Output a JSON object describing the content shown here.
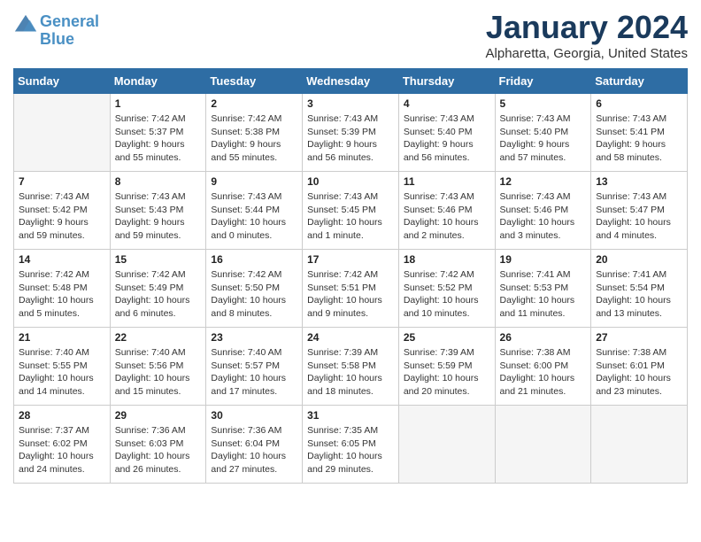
{
  "header": {
    "logo_line1": "General",
    "logo_line2": "Blue",
    "month_title": "January 2024",
    "location": "Alpharetta, Georgia, United States"
  },
  "weekdays": [
    "Sunday",
    "Monday",
    "Tuesday",
    "Wednesday",
    "Thursday",
    "Friday",
    "Saturday"
  ],
  "weeks": [
    [
      {
        "day": "",
        "sunrise": "",
        "sunset": "",
        "daylight": "",
        "empty": true
      },
      {
        "day": "1",
        "sunrise": "Sunrise: 7:42 AM",
        "sunset": "Sunset: 5:37 PM",
        "daylight": "Daylight: 9 hours and 55 minutes."
      },
      {
        "day": "2",
        "sunrise": "Sunrise: 7:42 AM",
        "sunset": "Sunset: 5:38 PM",
        "daylight": "Daylight: 9 hours and 55 minutes."
      },
      {
        "day": "3",
        "sunrise": "Sunrise: 7:43 AM",
        "sunset": "Sunset: 5:39 PM",
        "daylight": "Daylight: 9 hours and 56 minutes."
      },
      {
        "day": "4",
        "sunrise": "Sunrise: 7:43 AM",
        "sunset": "Sunset: 5:40 PM",
        "daylight": "Daylight: 9 hours and 56 minutes."
      },
      {
        "day": "5",
        "sunrise": "Sunrise: 7:43 AM",
        "sunset": "Sunset: 5:40 PM",
        "daylight": "Daylight: 9 hours and 57 minutes."
      },
      {
        "day": "6",
        "sunrise": "Sunrise: 7:43 AM",
        "sunset": "Sunset: 5:41 PM",
        "daylight": "Daylight: 9 hours and 58 minutes."
      }
    ],
    [
      {
        "day": "7",
        "sunrise": "Sunrise: 7:43 AM",
        "sunset": "Sunset: 5:42 PM",
        "daylight": "Daylight: 9 hours and 59 minutes."
      },
      {
        "day": "8",
        "sunrise": "Sunrise: 7:43 AM",
        "sunset": "Sunset: 5:43 PM",
        "daylight": "Daylight: 9 hours and 59 minutes."
      },
      {
        "day": "9",
        "sunrise": "Sunrise: 7:43 AM",
        "sunset": "Sunset: 5:44 PM",
        "daylight": "Daylight: 10 hours and 0 minutes."
      },
      {
        "day": "10",
        "sunrise": "Sunrise: 7:43 AM",
        "sunset": "Sunset: 5:45 PM",
        "daylight": "Daylight: 10 hours and 1 minute."
      },
      {
        "day": "11",
        "sunrise": "Sunrise: 7:43 AM",
        "sunset": "Sunset: 5:46 PM",
        "daylight": "Daylight: 10 hours and 2 minutes."
      },
      {
        "day": "12",
        "sunrise": "Sunrise: 7:43 AM",
        "sunset": "Sunset: 5:46 PM",
        "daylight": "Daylight: 10 hours and 3 minutes."
      },
      {
        "day": "13",
        "sunrise": "Sunrise: 7:43 AM",
        "sunset": "Sunset: 5:47 PM",
        "daylight": "Daylight: 10 hours and 4 minutes."
      }
    ],
    [
      {
        "day": "14",
        "sunrise": "Sunrise: 7:42 AM",
        "sunset": "Sunset: 5:48 PM",
        "daylight": "Daylight: 10 hours and 5 minutes."
      },
      {
        "day": "15",
        "sunrise": "Sunrise: 7:42 AM",
        "sunset": "Sunset: 5:49 PM",
        "daylight": "Daylight: 10 hours and 6 minutes."
      },
      {
        "day": "16",
        "sunrise": "Sunrise: 7:42 AM",
        "sunset": "Sunset: 5:50 PM",
        "daylight": "Daylight: 10 hours and 8 minutes."
      },
      {
        "day": "17",
        "sunrise": "Sunrise: 7:42 AM",
        "sunset": "Sunset: 5:51 PM",
        "daylight": "Daylight: 10 hours and 9 minutes."
      },
      {
        "day": "18",
        "sunrise": "Sunrise: 7:42 AM",
        "sunset": "Sunset: 5:52 PM",
        "daylight": "Daylight: 10 hours and 10 minutes."
      },
      {
        "day": "19",
        "sunrise": "Sunrise: 7:41 AM",
        "sunset": "Sunset: 5:53 PM",
        "daylight": "Daylight: 10 hours and 11 minutes."
      },
      {
        "day": "20",
        "sunrise": "Sunrise: 7:41 AM",
        "sunset": "Sunset: 5:54 PM",
        "daylight": "Daylight: 10 hours and 13 minutes."
      }
    ],
    [
      {
        "day": "21",
        "sunrise": "Sunrise: 7:40 AM",
        "sunset": "Sunset: 5:55 PM",
        "daylight": "Daylight: 10 hours and 14 minutes."
      },
      {
        "day": "22",
        "sunrise": "Sunrise: 7:40 AM",
        "sunset": "Sunset: 5:56 PM",
        "daylight": "Daylight: 10 hours and 15 minutes."
      },
      {
        "day": "23",
        "sunrise": "Sunrise: 7:40 AM",
        "sunset": "Sunset: 5:57 PM",
        "daylight": "Daylight: 10 hours and 17 minutes."
      },
      {
        "day": "24",
        "sunrise": "Sunrise: 7:39 AM",
        "sunset": "Sunset: 5:58 PM",
        "daylight": "Daylight: 10 hours and 18 minutes."
      },
      {
        "day": "25",
        "sunrise": "Sunrise: 7:39 AM",
        "sunset": "Sunset: 5:59 PM",
        "daylight": "Daylight: 10 hours and 20 minutes."
      },
      {
        "day": "26",
        "sunrise": "Sunrise: 7:38 AM",
        "sunset": "Sunset: 6:00 PM",
        "daylight": "Daylight: 10 hours and 21 minutes."
      },
      {
        "day": "27",
        "sunrise": "Sunrise: 7:38 AM",
        "sunset": "Sunset: 6:01 PM",
        "daylight": "Daylight: 10 hours and 23 minutes."
      }
    ],
    [
      {
        "day": "28",
        "sunrise": "Sunrise: 7:37 AM",
        "sunset": "Sunset: 6:02 PM",
        "daylight": "Daylight: 10 hours and 24 minutes."
      },
      {
        "day": "29",
        "sunrise": "Sunrise: 7:36 AM",
        "sunset": "Sunset: 6:03 PM",
        "daylight": "Daylight: 10 hours and 26 minutes."
      },
      {
        "day": "30",
        "sunrise": "Sunrise: 7:36 AM",
        "sunset": "Sunset: 6:04 PM",
        "daylight": "Daylight: 10 hours and 27 minutes."
      },
      {
        "day": "31",
        "sunrise": "Sunrise: 7:35 AM",
        "sunset": "Sunset: 6:05 PM",
        "daylight": "Daylight: 10 hours and 29 minutes."
      },
      {
        "day": "",
        "sunrise": "",
        "sunset": "",
        "daylight": "",
        "empty": true
      },
      {
        "day": "",
        "sunrise": "",
        "sunset": "",
        "daylight": "",
        "empty": true
      },
      {
        "day": "",
        "sunrise": "",
        "sunset": "",
        "daylight": "",
        "empty": true
      }
    ]
  ]
}
